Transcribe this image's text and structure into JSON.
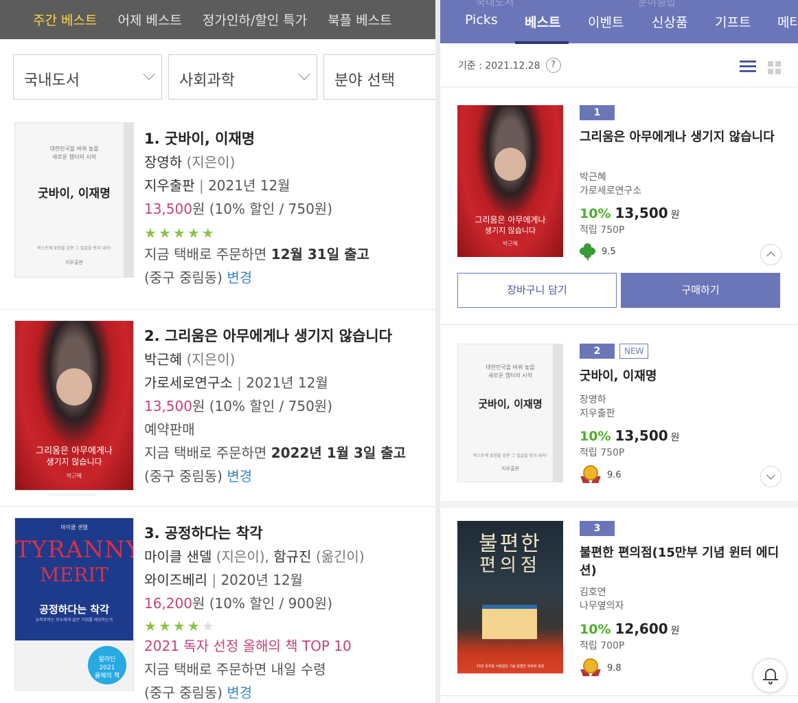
{
  "left": {
    "tabs": [
      {
        "label": "주간 베스트",
        "active": true
      },
      {
        "label": "어제 베스트",
        "active": false
      },
      {
        "label": "정가인하/할인 특가",
        "active": false
      },
      {
        "label": "북플 베스트",
        "active": false
      }
    ],
    "filters": [
      "국내도서",
      "사회과학",
      "분야 선택"
    ],
    "books": [
      {
        "title": "1. 굿바이, 이재명",
        "author": "장영하",
        "author_role": "(지은이)",
        "publisher": "지우출판",
        "date": "2021년 12월",
        "price": "13,500",
        "price_unit": "원",
        "discount": "(10% 할인 / 750원)",
        "rating_stars": 5,
        "ship_prefix": "지금 택배로 주문하면 ",
        "ship_strong": "12월 31일 출고",
        "location": "(중구 중림동) ",
        "change": "변경",
        "cover": {
          "small_lines": "대한민국을 바꿔 놓을\n새로운 챕터의 시작",
          "big": "굿바이, 이재명",
          "tiny": "버스트에 표정을 감춘 그 얼굴을 벗겨 내라!",
          "pub": "지우출판"
        }
      },
      {
        "title": "2. 그리움은 아무에게나 생기지 않습니다",
        "author": "박근혜",
        "author_role": "(지은이)",
        "publisher": "가로세로연구소",
        "date": "2021년 12월",
        "price": "13,500",
        "price_unit": "원",
        "discount": "(10% 할인 / 750원)",
        "status": "예약판매",
        "ship_prefix": "지금 택배로 주문하면 ",
        "ship_strong": "2022년 1월 3일 출고",
        "location": "(중구 중림동) ",
        "change": "변경",
        "cover": {
          "line1": "그리움은 아무에게나",
          "line2": "생기지 않습니다",
          "author": "박근혜"
        }
      },
      {
        "title": "3. 공정하다는 착각",
        "author": "마이클 샌델",
        "author_role": "(지은이), ",
        "translator": "함규진",
        "translator_role": "(옮긴이)",
        "publisher": "와이즈베리",
        "date": "2020년 12월",
        "price": "16,200",
        "price_unit": "원",
        "discount": "(10% 할인 / 900원)",
        "rating_stars": 4,
        "award": "2021 독자 선정 올해의 책 TOP 10",
        "ship_prefix": "지금 택배로 주문하면 내일 수령",
        "location": "(중구 중림동) ",
        "change": "변경",
        "cover": {
          "top": "마이클 샌델",
          "big1": "TYRANNY",
          "big2": "MERIT",
          "ko": "공정하다는 착각",
          "sub": "능력주의는 모두에게 같은 기회를 제공하는가",
          "badge": "알라딘\n2021\n올해의 책"
        }
      }
    ]
  },
  "right": {
    "ghost_tabs": [
      "국내도서",
      "분야종합"
    ],
    "nav": [
      {
        "label": "Picks",
        "active": false
      },
      {
        "label": "베스트",
        "active": true
      },
      {
        "label": "이벤트",
        "active": false
      },
      {
        "label": "신상품",
        "active": false
      },
      {
        "label": "기프트",
        "active": false
      },
      {
        "label": "메타",
        "active": false
      }
    ],
    "date_label": "기준 : 2021.12.28",
    "help": "?",
    "books": [
      {
        "rank": "1",
        "title": "그리움은 아무에게나 생기지 않습니다",
        "author": "박근혜",
        "publisher": "가로세로연구소",
        "pct": "10%",
        "price": "13,500",
        "won": "원",
        "points": "적립 750P",
        "rating": "9.5",
        "rating_icon": "clover-icon",
        "cover": {
          "line1": "그리움은 아무에게나",
          "line2": "생기지 않습니다",
          "author": "박근혜"
        }
      },
      {
        "rank": "2",
        "new": "NEW",
        "title": "굿바이, 이재명",
        "author": "장영하",
        "publisher": "지우출판",
        "pct": "10%",
        "price": "13,500",
        "won": "원",
        "points": "적립 750P",
        "rating": "9.6",
        "rating_icon": "medal-icon",
        "cover": {
          "small_lines": "대한민국을 바꿔 놓을\n새로운 챕터의 시작",
          "big": "굿바이, 이재명",
          "tiny": "버스트에 표정을 감춘 그 얼굴을 벗겨 내라!",
          "pub": "지우출판"
        }
      },
      {
        "rank": "3",
        "title": "불편한 편의점(15만부 기념 윈터 에디션)",
        "author": "김호연",
        "publisher": "나무옆의자",
        "pct": "10%",
        "price": "12,600",
        "won": "원",
        "points": "적립 700P",
        "rating": "9.8",
        "rating_icon": "medal-icon",
        "cover": {
          "t1": "불편한",
          "t2": "편의점",
          "caption": "15만 독자를 사로잡은 가슴 뭉클한 위로와 응원"
        }
      }
    ],
    "buttons": {
      "cart": "장바구니 담기",
      "buy": "구매하기"
    }
  }
}
